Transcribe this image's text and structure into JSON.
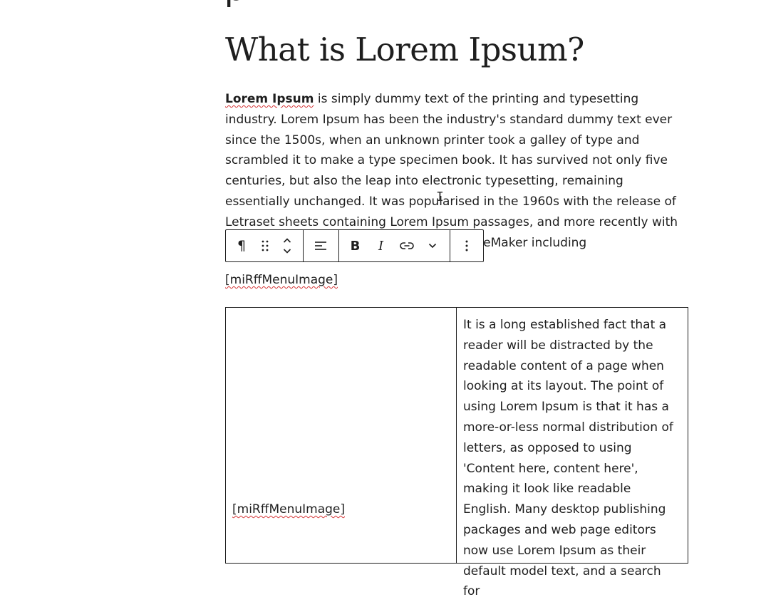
{
  "post": {
    "heading": "What is Lorem Ipsum?",
    "cut_heading": "ρ",
    "intro_bold": "Lorem Ipsum",
    "intro_text": " is simply dummy text of the printing and typesetting industry. Lorem Ipsum has been the industry's standard dummy text ever since the 1500s, when an unknown printer took a galley of type and scrambled it to make a type specimen book. It has survived not only five centuries, but also the leap into electronic typesetting, remaining essentially unchanged. It was popularised in the 1960s with the release of Letraset sheets containing Lorem Ipsum passages, and more recently with desktop publishing software like Aldus PageMaker including",
    "shortcode": "[miRffMenuImage]"
  },
  "toolbar": {
    "paragraph_icon": "¶",
    "bold_label": "B",
    "italic_label": "I",
    "icons": [
      "paragraph-icon",
      "drag-handle-icon",
      "move-up-icon",
      "move-down-icon",
      "align-left-icon",
      "bold-icon",
      "italic-icon",
      "link-icon",
      "chevron-down-icon",
      "more-options-icon"
    ]
  },
  "table": {
    "left_cell": "[miRffMenuImage]",
    "right_cell": "It is a long established fact that a reader will be distracted by the readable content of a page when looking at its layout. The point of using Lorem Ipsum is that it has a more-or-less normal distribution of letters, as opposed to using 'Content here, content here', making it look like readable English. Many desktop publishing packages and web page editors now use Lorem Ipsum as their default model text, and a search for"
  },
  "colors": {
    "text": "#1e1e1e",
    "spellcheck": "#d63638",
    "border": "#1e1e1e",
    "background": "#ffffff"
  }
}
